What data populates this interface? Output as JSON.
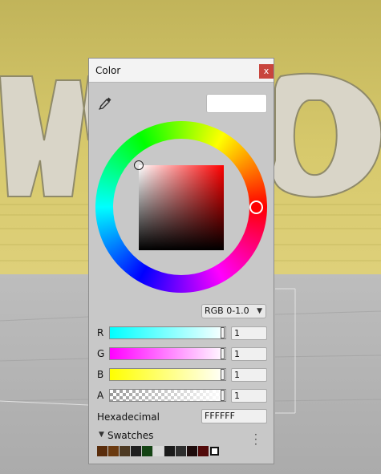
{
  "window": {
    "title": "Color",
    "close_label": "x"
  },
  "colors": {
    "current": "#FFFFFF",
    "accent_close": "#c8453d"
  },
  "icons": {
    "eyedropper": "eyedropper-icon",
    "close": "close-icon",
    "menu": "kebab-menu-icon",
    "collapse": "triangle-down-icon"
  },
  "wheel": {
    "hue_handle_color": "#FF0000",
    "square_hue": "#FF0000"
  },
  "mode": {
    "selected": "RGB 0-1.0"
  },
  "channels": [
    {
      "label": "R",
      "value": "1",
      "level": 1.0
    },
    {
      "label": "G",
      "value": "1",
      "level": 1.0
    },
    {
      "label": "B",
      "value": "1",
      "level": 1.0
    },
    {
      "label": "A",
      "value": "1",
      "level": 1.0
    }
  ],
  "hex": {
    "label": "Hexadecimal",
    "value": "FFFFFF"
  },
  "swatches": {
    "label": "Swatches",
    "colors": [
      "#5a2d0c",
      "#6b3a10",
      "#4e3a23",
      "#1f1f1f",
      "#144314",
      "#d8d8d8",
      "#1a1a1a",
      "#2e2e2e",
      "#1e0c0c",
      "#520a0a"
    ]
  }
}
